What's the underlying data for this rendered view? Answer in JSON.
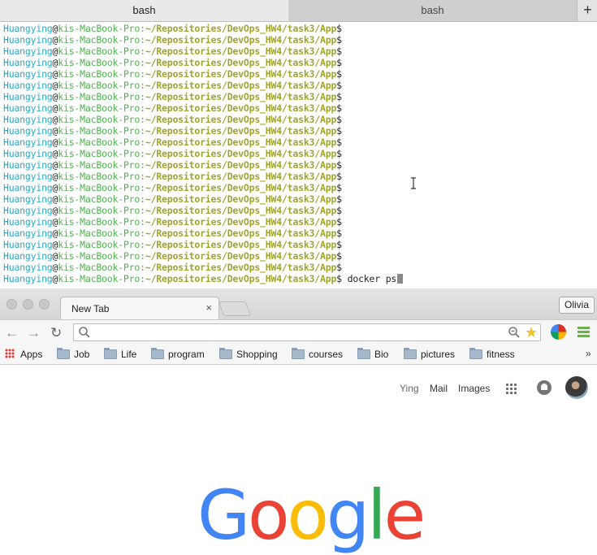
{
  "terminal": {
    "tabs": [
      {
        "label": "bash",
        "active": true
      },
      {
        "label": "bash",
        "active": false
      }
    ],
    "new_tab_label": "+",
    "prompt": {
      "user": "Huangying",
      "at": "@",
      "host": "kis-MacBook-Pro",
      "colon": ":",
      "path": "~/Repositories/DevOps_HW4/task3/App",
      "dollar": "$"
    },
    "current_command": " docker ps",
    "colors": {
      "user": "#2aa9c6",
      "host": "#4db34d",
      "path": "#a0a52a"
    }
  },
  "chrome": {
    "tab_title": "New Tab",
    "tab_close": "×",
    "profile_name": "Olivia",
    "nav": {
      "back": "←",
      "forward": "→",
      "reload": "↻"
    },
    "omnibox_value": "",
    "bookmarks": [
      {
        "label": "Apps",
        "icon": "apps-grid-icon"
      },
      {
        "label": "Job",
        "icon": "folder-icon"
      },
      {
        "label": "Life",
        "icon": "folder-icon"
      },
      {
        "label": "program",
        "icon": "folder-icon"
      },
      {
        "label": "Shopping",
        "icon": "folder-icon"
      },
      {
        "label": "courses",
        "icon": "folder-icon"
      },
      {
        "label": "Bio",
        "icon": "folder-icon"
      },
      {
        "label": "pictures",
        "icon": "folder-icon"
      },
      {
        "label": "fitness",
        "icon": "folder-icon"
      }
    ],
    "bookmarks_more": "»",
    "ntp": {
      "user_link": "Ying",
      "mail_link": "Mail",
      "images_link": "Images",
      "logo": [
        "G",
        "o",
        "o",
        "g",
        "l",
        "e"
      ]
    }
  }
}
